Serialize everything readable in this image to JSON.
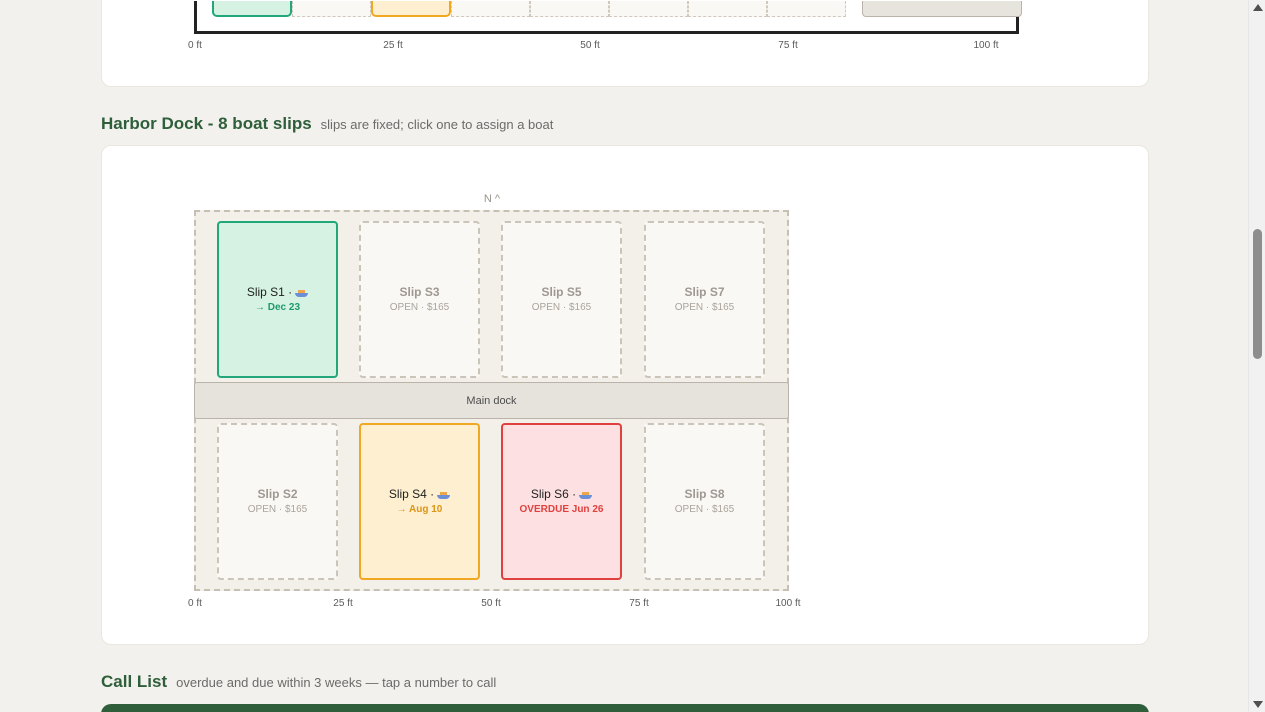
{
  "top_section": {
    "axis_ticks": [
      "0 ft",
      "25 ft",
      "50 ft",
      "75 ft",
      "100 ft"
    ]
  },
  "harbor": {
    "title": "Harbor Dock - 8 boat slips",
    "subtitle": "slips are fixed; click one to assign a boat",
    "north_label": "N ^",
    "dock_label": "Main dock",
    "axis_ticks": [
      "0 ft",
      "25 ft",
      "50 ft",
      "75 ft",
      "100 ft"
    ],
    "slips": [
      {
        "id": "S1",
        "label": "Slip S1 ·",
        "status_text": "→ Dec 23",
        "state": "green",
        "occupied": true,
        "icon": "boat-icon"
      },
      {
        "id": "S3",
        "label": "Slip S3",
        "status_text": "OPEN · $165",
        "state": "open",
        "occupied": false
      },
      {
        "id": "S5",
        "label": "Slip S5",
        "status_text": "OPEN · $165",
        "state": "open",
        "occupied": false
      },
      {
        "id": "S7",
        "label": "Slip S7",
        "status_text": "OPEN · $165",
        "state": "open",
        "occupied": false
      },
      {
        "id": "S2",
        "label": "Slip S2",
        "status_text": "OPEN · $165",
        "state": "open",
        "occupied": false
      },
      {
        "id": "S4",
        "label": "Slip S4 ·",
        "status_text": "→ Aug 10",
        "state": "yellow",
        "occupied": true,
        "icon": "boat-icon"
      },
      {
        "id": "S6",
        "label": "Slip S6 ·",
        "status_text": "OVERDUE Jun 26",
        "state": "red",
        "occupied": true,
        "icon": "boat-icon"
      },
      {
        "id": "S8",
        "label": "Slip S8",
        "status_text": "OPEN · $165",
        "state": "open",
        "occupied": false
      }
    ]
  },
  "call_list": {
    "title": "Call List",
    "subtitle": "overdue and due within 3 weeks — tap a number to call"
  },
  "colors": {
    "accent_green": "#2e5e3a",
    "slip_current": "#22a77b",
    "slip_due_soon": "#f0a822",
    "slip_overdue": "#e0413f"
  }
}
